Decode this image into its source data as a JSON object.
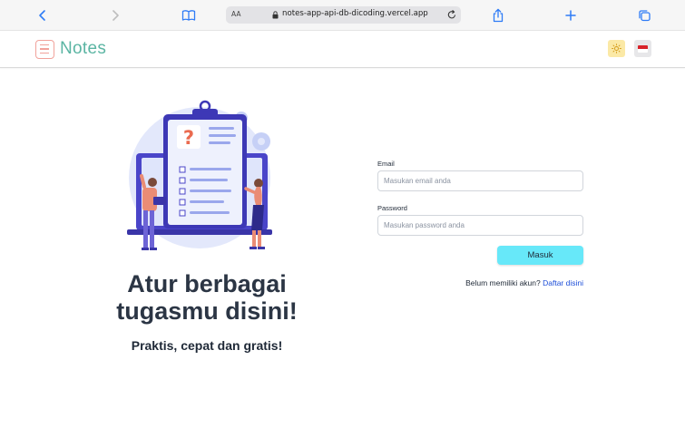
{
  "browser": {
    "text_size_label": "AA",
    "url": "notes-app-api-db-dicoding.vercel.app"
  },
  "header": {
    "app_name": "Notes",
    "theme_icon": "sun-icon",
    "lang_icon": "indonesia-flag-icon"
  },
  "hero": {
    "title": "Atur berbagai tugasmu disini!",
    "subtitle": "Praktis, cepat dan gratis!"
  },
  "login_form": {
    "email_label": "Email",
    "email_placeholder": "Masukan email anda",
    "email_value": "",
    "password_label": "Password",
    "password_placeholder": "Masukan password anda",
    "password_value": "",
    "submit_label": "Masuk",
    "register_prompt": "Belum memiliki akun?",
    "register_link": "Daftar disini"
  },
  "colors": {
    "accent": "#67e8f9",
    "logo_text": "#5bb5a3",
    "logo_mark": "#f1a29b",
    "link": "#1d4ed8",
    "title": "#2b3544"
  }
}
